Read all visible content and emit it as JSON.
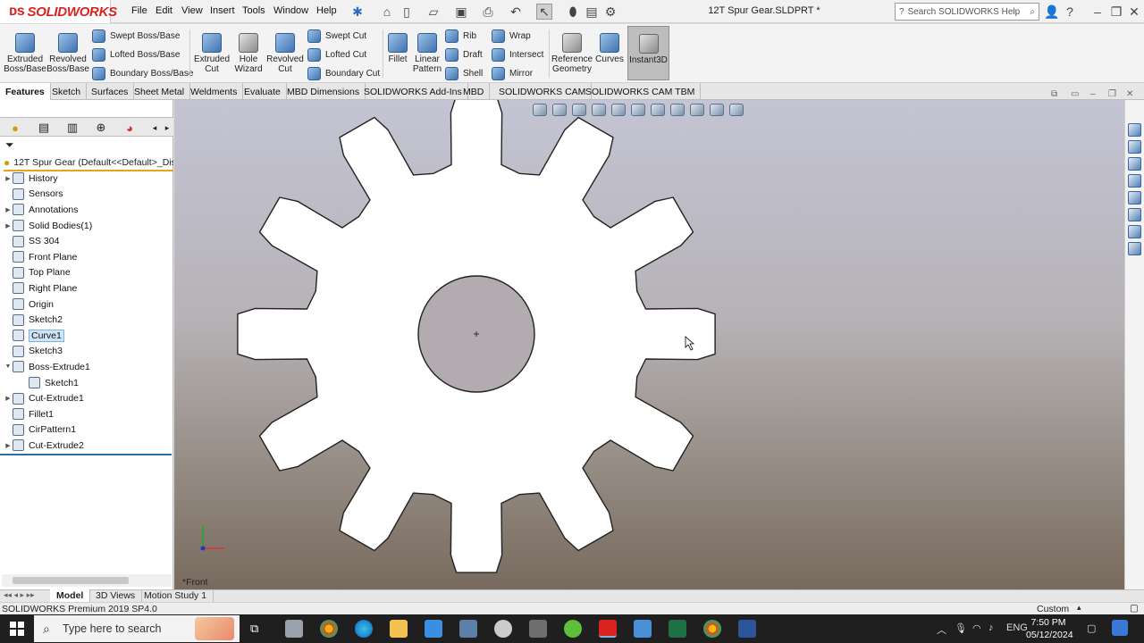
{
  "app": {
    "brand": "SOLIDWORKS",
    "doc_title": "12T Spur Gear.SLDPRT *",
    "search_placeholder": "Search SOLIDWORKS Help"
  },
  "menu": [
    "File",
    "Edit",
    "View",
    "Insert",
    "Tools",
    "Window",
    "Help"
  ],
  "ribbon": {
    "extruded_boss": "Extruded\nBoss/Base",
    "revolved_boss": "Revolved\nBoss/Base",
    "swept_boss": "Swept Boss/Base",
    "lofted_boss": "Lofted Boss/Base",
    "boundary_boss": "Boundary Boss/Base",
    "extruded_cut": "Extruded\nCut",
    "hole_wizard": "Hole\nWizard",
    "revolved_cut": "Revolved\nCut",
    "swept_cut": "Swept Cut",
    "lofted_cut": "Lofted Cut",
    "boundary_cut": "Boundary Cut",
    "fillet": "Fillet",
    "linear_pattern": "Linear\nPattern",
    "rib": "Rib",
    "draft": "Draft",
    "shell": "Shell",
    "wrap": "Wrap",
    "intersect": "Intersect",
    "mirror": "Mirror",
    "reference_geometry": "Reference\nGeometry",
    "curves": "Curves",
    "instant3d": "Instant3D"
  },
  "tabs": [
    "Features",
    "Sketch",
    "Surfaces",
    "Sheet Metal",
    "Weldments",
    "Evaluate",
    "MBD Dimensions",
    "SOLIDWORKS Add-Ins",
    "MBD",
    "SOLIDWORKS CAM",
    "SOLIDWORKS CAM TBM"
  ],
  "tree": {
    "root": "12T Spur Gear  (Default<<Default>_Displ",
    "items": [
      {
        "label": "History",
        "expandable": true,
        "indent": 0
      },
      {
        "label": "Sensors",
        "expandable": false,
        "indent": 0
      },
      {
        "label": "Annotations",
        "expandable": true,
        "indent": 0
      },
      {
        "label": "Solid Bodies(1)",
        "expandable": true,
        "indent": 0
      },
      {
        "label": "SS 304",
        "expandable": false,
        "indent": 0
      },
      {
        "label": "Front Plane",
        "expandable": false,
        "indent": 0
      },
      {
        "label": "Top Plane",
        "expandable": false,
        "indent": 0
      },
      {
        "label": "Right Plane",
        "expandable": false,
        "indent": 0
      },
      {
        "label": "Origin",
        "expandable": false,
        "indent": 0
      },
      {
        "label": "Sketch2",
        "expandable": false,
        "indent": 0
      },
      {
        "label": "Curve1",
        "expandable": false,
        "indent": 0,
        "selected": true
      },
      {
        "label": "Sketch3",
        "expandable": false,
        "indent": 0
      },
      {
        "label": "Boss-Extrude1",
        "expandable": true,
        "expanded": true,
        "indent": 0
      },
      {
        "label": "Sketch1",
        "expandable": false,
        "indent": 1
      },
      {
        "label": "Cut-Extrude1",
        "expandable": true,
        "indent": 0
      },
      {
        "label": "Fillet1",
        "expandable": false,
        "indent": 0
      },
      {
        "label": "CirPattern1",
        "expandable": false,
        "indent": 0
      },
      {
        "label": "Cut-Extrude2",
        "expandable": true,
        "indent": 0
      }
    ]
  },
  "viewport": {
    "view_label": "*Front",
    "gear_teeth": 12
  },
  "bottom_tabs": [
    "Model",
    "3D Views",
    "Motion Study 1"
  ],
  "status": {
    "left": "SOLIDWORKS Premium 2019 SP4.0",
    "units": "Custom"
  },
  "taskbar": {
    "search_placeholder": "Type here to search",
    "lang": "ENG",
    "time": "7:50 PM",
    "date": "05/12/2024"
  }
}
